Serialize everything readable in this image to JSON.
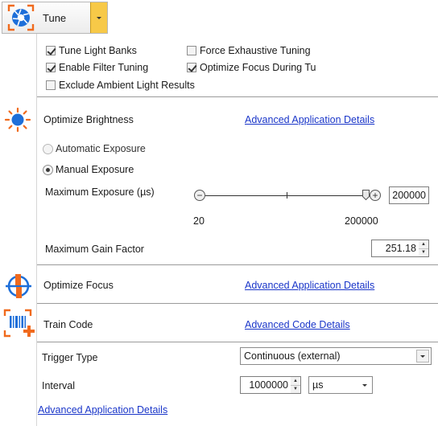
{
  "toolbar": {
    "tune_label": "Tune",
    "accent_color": "#f7c948"
  },
  "options": {
    "tune_light_banks": {
      "label": "Tune Light Banks",
      "checked": true
    },
    "force_exhaustive": {
      "label": "Force Exhaustive Tuning",
      "checked": false
    },
    "enable_filter": {
      "label": "Enable Filter Tuning",
      "checked": true
    },
    "optimize_focus_during": {
      "label": "Optimize Focus During Tu",
      "checked": true
    },
    "exclude_ambient": {
      "label": "Exclude Ambient Light Results",
      "checked": false
    }
  },
  "brightness": {
    "title": "Optimize Brightness",
    "link": "Advanced Application Details",
    "auto_exposure": "Automatic Exposure",
    "manual_exposure": "Manual Exposure",
    "max_exposure_label": "Maximum Exposure (µs)",
    "max_exposure_value": "200000",
    "slider_min": "20",
    "slider_max": "200000",
    "slider_level": 1.0,
    "gain_label": "Maximum Gain Factor",
    "gain_value": "251.18"
  },
  "focus": {
    "title": "Optimize Focus",
    "link": "Advanced Application Details"
  },
  "train": {
    "title": "Train Code",
    "link": "Advanced Code Details"
  },
  "trigger": {
    "type_label": "Trigger Type",
    "type_value": "Continuous (external)",
    "interval_label": "Interval",
    "interval_value": "1000000",
    "interval_unit": "µs"
  },
  "footer": {
    "link": "Advanced Application Details"
  },
  "icons": {
    "tune": "tune-aperture-icon",
    "brightness": "sun-icon",
    "focus": "focus-crosshair-icon",
    "train": "barcode-add-icon"
  },
  "colors": {
    "link": "#1a36c9",
    "icon_blue": "#1e6fd9",
    "icon_orange": "#f06a1d"
  }
}
